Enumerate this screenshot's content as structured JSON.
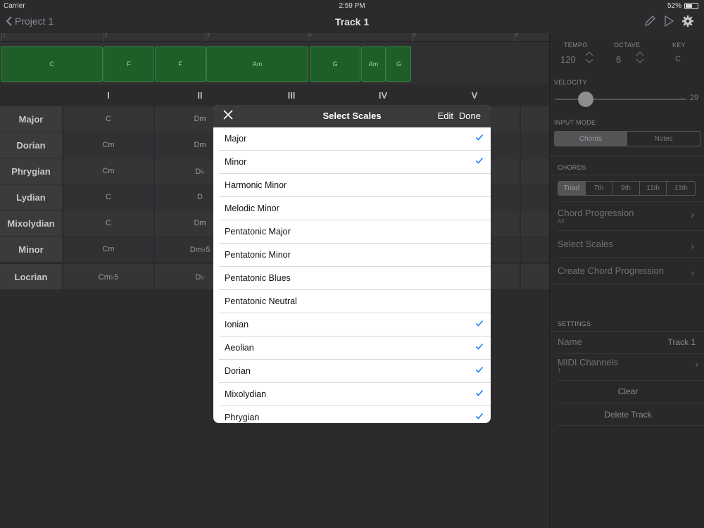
{
  "status": {
    "carrier": "Carrier",
    "time": "2:59 PM",
    "battery": "52%"
  },
  "nav": {
    "back": "Project 1",
    "title": "Track 1"
  },
  "ruler": {
    "marks": [
      "1",
      "2",
      "3",
      "4",
      "5",
      "6"
    ]
  },
  "clips": [
    "C",
    "F",
    "F",
    "Am",
    "G",
    "Am",
    "G"
  ],
  "grid": {
    "degrees": [
      "I",
      "II",
      "III",
      "IV",
      "V"
    ],
    "rows": [
      {
        "name": "Major",
        "cells": [
          "C",
          "Dm"
        ]
      },
      {
        "name": "Dorian",
        "cells": [
          "Cm",
          "Dm"
        ]
      },
      {
        "name": "Phrygian",
        "cells": [
          "Cm",
          "D♭"
        ]
      },
      {
        "name": "Lydian",
        "cells": [
          "C",
          "D"
        ]
      },
      {
        "name": "Mixolydian",
        "cells": [
          "C",
          "Dm"
        ]
      },
      {
        "name": "Minor",
        "cells": [
          "Cm",
          "Dm♭5"
        ]
      },
      {
        "name": "Locrian",
        "cells": [
          "Cm♭5",
          "D♭"
        ]
      }
    ]
  },
  "panel": {
    "tempo_label": "TEMPO",
    "tempo_value": "120",
    "octave_label": "OCTAVE",
    "octave_value": "6",
    "key_label": "KEY",
    "key_value": "C",
    "velocity_label": "VELOCITY",
    "velocity_value": "29",
    "velocity_fraction": 0.23,
    "input_mode_label": "INPUT MODE",
    "input_modes": [
      "Chords",
      "Notes"
    ],
    "input_mode_selected": "Chords",
    "chords_label": "CHORDS",
    "chord_types": [
      "Triad",
      "7th",
      "9th",
      "11th",
      "13th"
    ],
    "chord_type_selected": "Triad",
    "chord_progression": "Chord Progression",
    "chord_progression_sub": "All",
    "select_scales": "Select Scales",
    "create_progression": "Create Chord Progression",
    "settings_label": "SETTINGS",
    "name_label": "Name",
    "name_value": "Track 1",
    "midi_label": "MIDI Channels",
    "midi_sub": "1",
    "clear": "Clear",
    "delete": "Delete Track"
  },
  "modal": {
    "title": "Select Scales",
    "edit": "Edit",
    "done": "Done",
    "items": [
      {
        "label": "Major",
        "checked": true
      },
      {
        "label": "Minor",
        "checked": true
      },
      {
        "label": "Harmonic Minor",
        "checked": false
      },
      {
        "label": "Melodic Minor",
        "checked": false
      },
      {
        "label": "Pentatonic Major",
        "checked": false
      },
      {
        "label": "Pentatonic Minor",
        "checked": false
      },
      {
        "label": "Pentatonic Blues",
        "checked": false
      },
      {
        "label": "Pentatonic Neutral",
        "checked": false
      },
      {
        "label": "Ionian",
        "checked": true
      },
      {
        "label": "Aeolian",
        "checked": true
      },
      {
        "label": "Dorian",
        "checked": true
      },
      {
        "label": "Mixolydian",
        "checked": true
      },
      {
        "label": "Phrygian",
        "checked": true
      }
    ]
  },
  "colors": {
    "accent": "#1e7ef0",
    "clip": "#1f5e28",
    "panel": "#29292b"
  }
}
